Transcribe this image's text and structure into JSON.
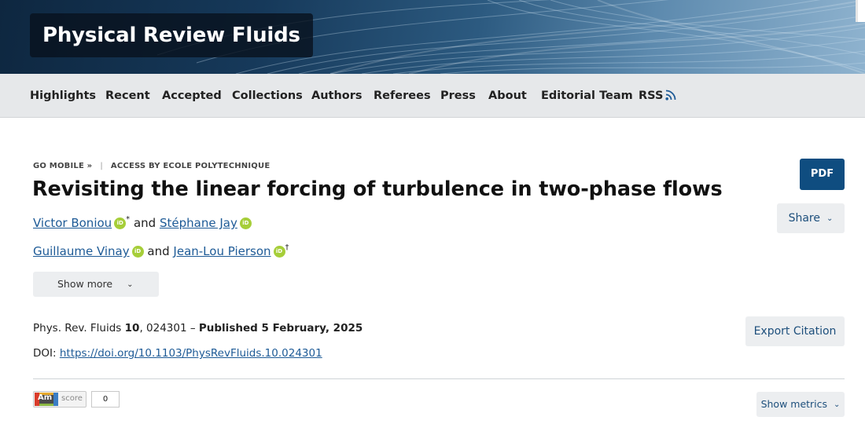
{
  "header": {
    "journal_title": "Physical Review Fluids"
  },
  "nav": {
    "items": [
      {
        "label": "Highlights"
      },
      {
        "label": "Recent"
      },
      {
        "label": "Accepted"
      },
      {
        "label": "Collections"
      },
      {
        "label": "Authors"
      },
      {
        "label": "Referees"
      },
      {
        "label": "Press"
      },
      {
        "label": "About"
      },
      {
        "label": "Editorial Team"
      },
      {
        "label": "RSS"
      }
    ]
  },
  "breadcrumb": {
    "go_mobile": "GO MOBILE »",
    "separator": "|",
    "access": "ACCESS BY ECOLE POLYTECHNIQUE"
  },
  "article": {
    "title": "Revisiting the linear forcing of turbulence in two-phase flows",
    "authors": [
      {
        "name": "Victor Boniou",
        "mark": "*"
      },
      {
        "name": "Stéphane Jay",
        "mark": ""
      },
      {
        "name": "Guillaume Vinay",
        "mark": ""
      },
      {
        "name": "Jean-Lou Pierson",
        "mark": "†"
      }
    ],
    "conjunction": "and",
    "orcid_label": "iD",
    "show_more_label": "Show more",
    "citation": {
      "journal": "Phys. Rev. Fluids",
      "volume": "10",
      "article_number": ", 024301 – ",
      "published": "Published 5 February, 2025"
    },
    "doi_label": "DOI: ",
    "doi_url": "https://doi.org/10.1103/PhysRevFluids.10.024301"
  },
  "actions": {
    "pdf_label": "PDF",
    "share_label": "Share",
    "export_label": "Export Citation",
    "metrics_label": "Show metrics"
  },
  "altmetric": {
    "badge_text": "Am",
    "score_label": "score",
    "score_value": "0"
  },
  "colors": {
    "link": "#1d5a96",
    "pdf_button": "#0f4d80",
    "orcid": "#a6ce39"
  }
}
